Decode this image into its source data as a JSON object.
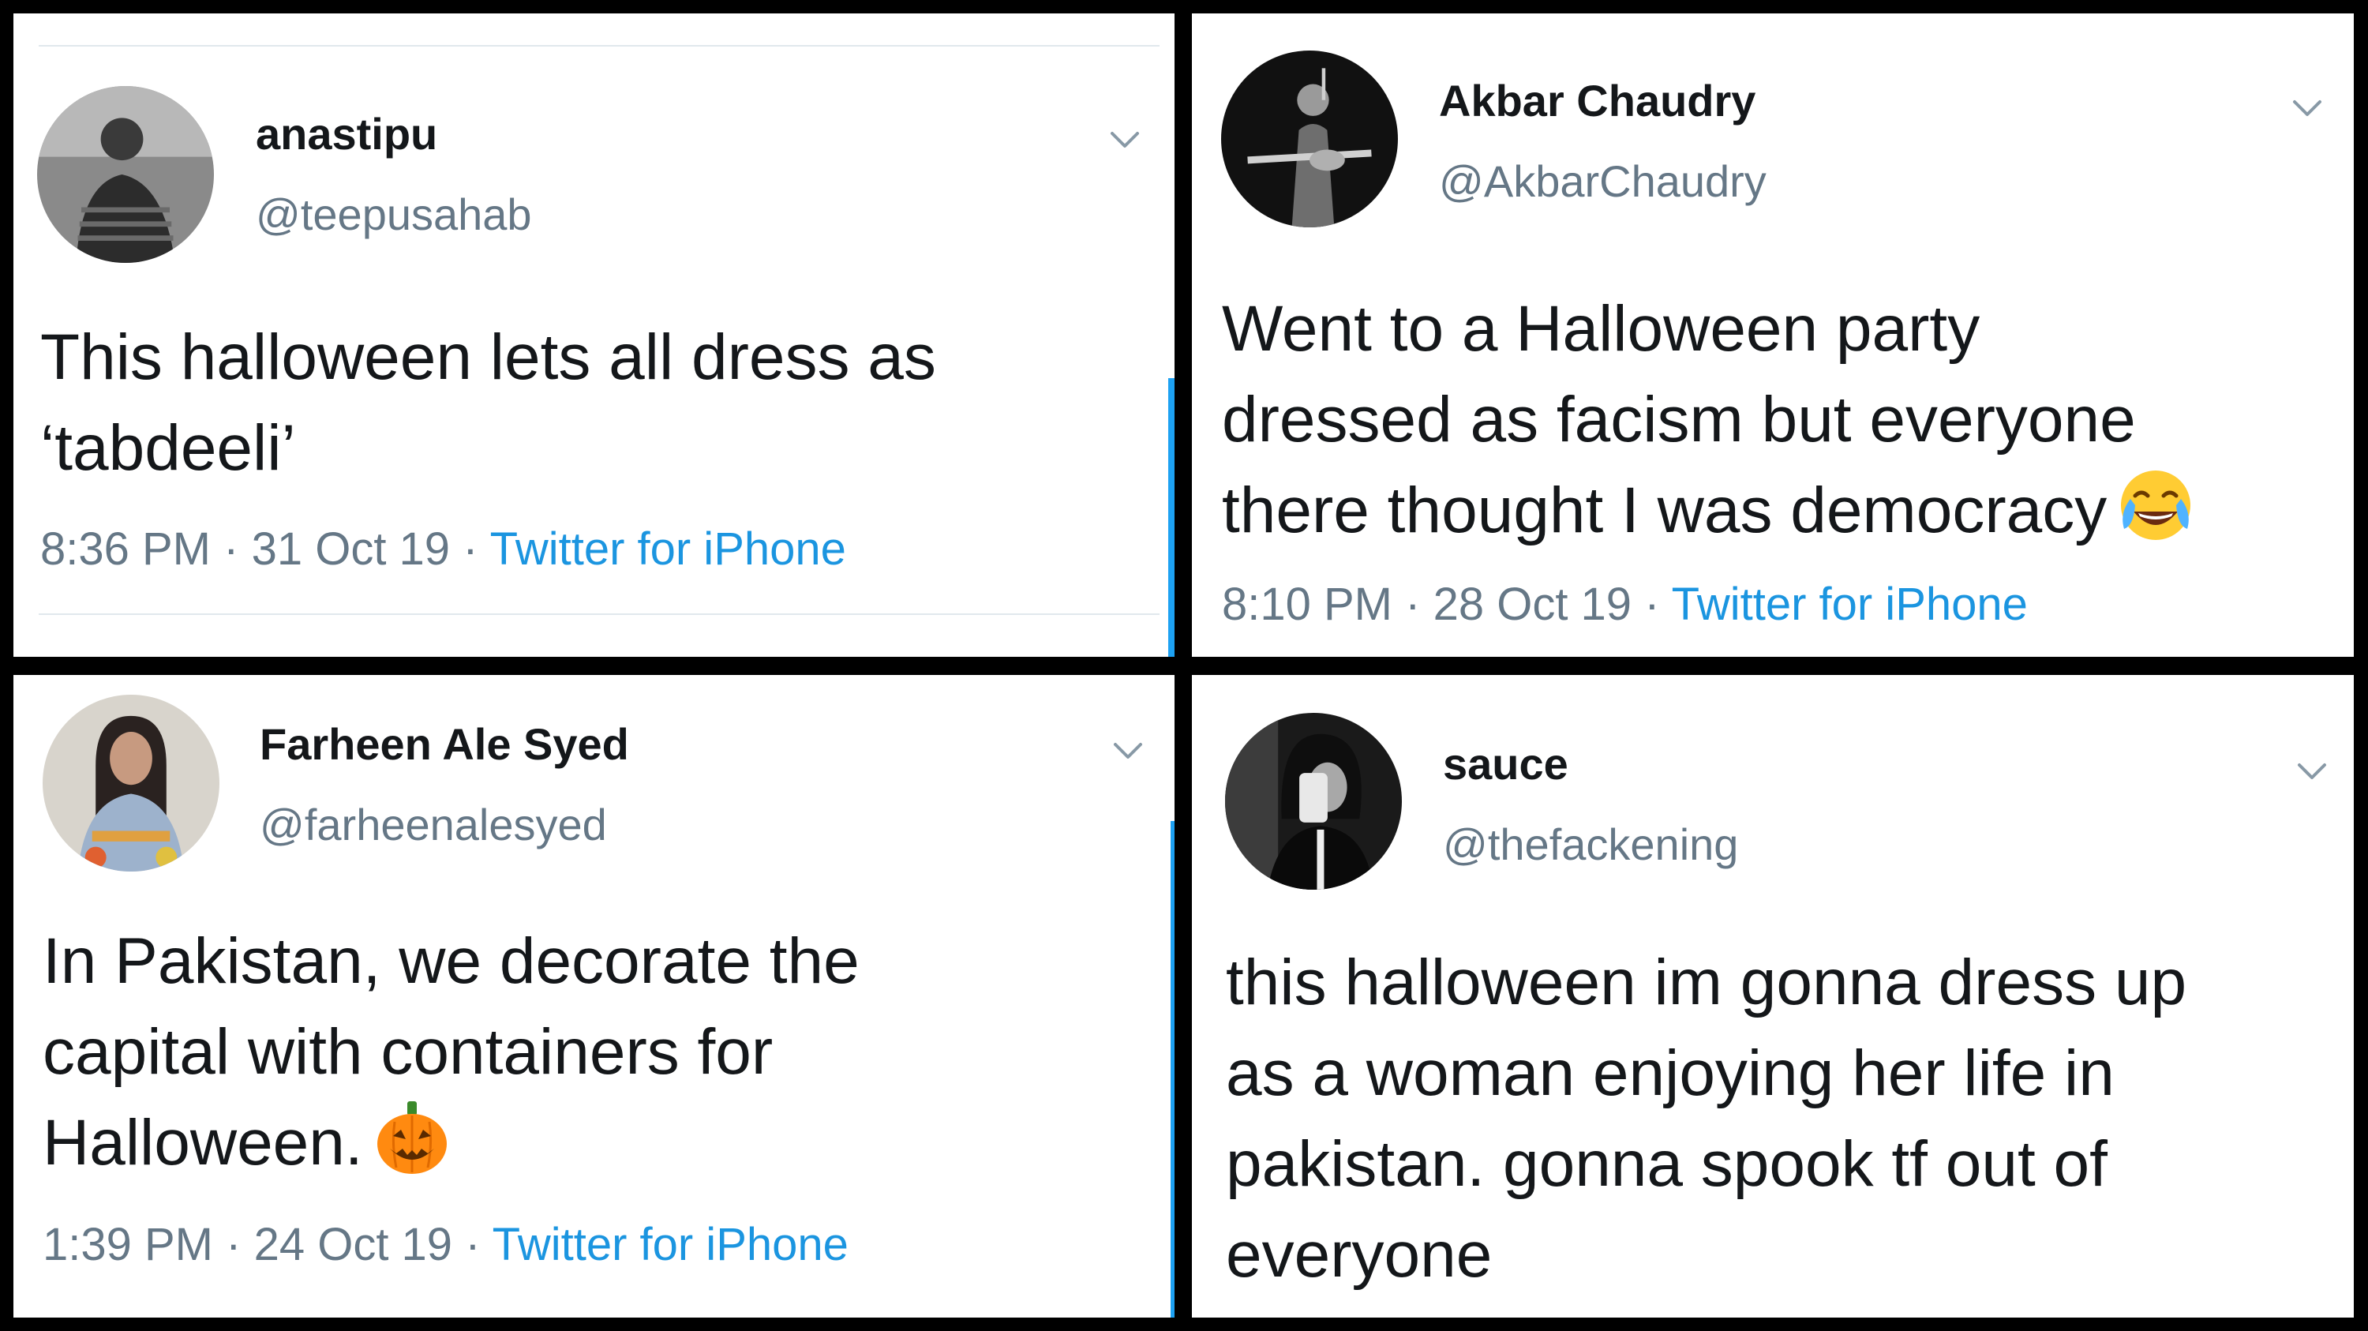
{
  "tweets": [
    {
      "name": "anastipu",
      "handle": "@teepusahab",
      "lines": [
        "This halloween lets all dress as",
        "‘tabdeeli’"
      ],
      "time": "8:36 PM",
      "date": "31 Oct 19",
      "source": "Twitter for iPhone",
      "sep": "·"
    },
    {
      "name": "Akbar Chaudry",
      "handle": "@AkbarChaudry",
      "lines": [
        "Went to a Halloween party",
        "dressed as facism but everyone",
        "there thought I was democracy"
      ],
      "emoji": "face-with-tears-of-joy-emoji",
      "time": "8:10 PM",
      "date": "28 Oct 19",
      "source": "Twitter for iPhone",
      "sep": "·"
    },
    {
      "name": "Farheen Ale Syed",
      "handle": "@farheenalesyed",
      "lines": [
        "In Pakistan, we decorate the",
        "capital with containers for",
        "Halloween."
      ],
      "emoji": "jack-o-lantern-emoji",
      "time": "1:39 PM",
      "date": "24 Oct 19",
      "source": "Twitter for iPhone",
      "sep": "·"
    },
    {
      "name": "sauce",
      "handle": "@thefackening",
      "lines": [
        "this halloween im gonna dress up",
        "as a woman enjoying her life in",
        "pakistan.  gonna spook tf out of",
        "everyone"
      ]
    }
  ],
  "colors": {
    "text": "#14171a",
    "secondary": "#657786",
    "link": "#1b95e0",
    "background": "#ffffff",
    "border": "#000000"
  },
  "icons": {
    "menu": "chevron-down-icon",
    "avatar": "avatar"
  }
}
